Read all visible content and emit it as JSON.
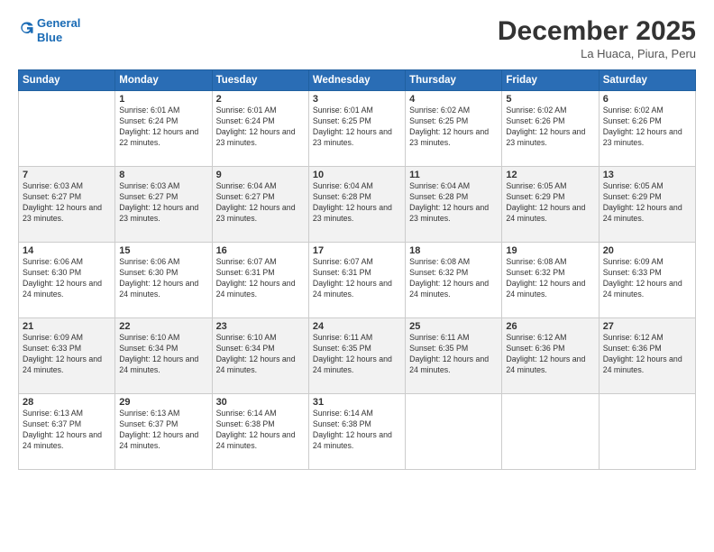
{
  "header": {
    "logo_line1": "General",
    "logo_line2": "Blue",
    "month": "December 2025",
    "location": "La Huaca, Piura, Peru"
  },
  "weekdays": [
    "Sunday",
    "Monday",
    "Tuesday",
    "Wednesday",
    "Thursday",
    "Friday",
    "Saturday"
  ],
  "weeks": [
    [
      {
        "day": "",
        "sunrise": "",
        "sunset": "",
        "daylight": ""
      },
      {
        "day": "1",
        "sunrise": "6:01 AM",
        "sunset": "6:24 PM",
        "daylight": "12 hours and 22 minutes."
      },
      {
        "day": "2",
        "sunrise": "6:01 AM",
        "sunset": "6:24 PM",
        "daylight": "12 hours and 23 minutes."
      },
      {
        "day": "3",
        "sunrise": "6:01 AM",
        "sunset": "6:25 PM",
        "daylight": "12 hours and 23 minutes."
      },
      {
        "day": "4",
        "sunrise": "6:02 AM",
        "sunset": "6:25 PM",
        "daylight": "12 hours and 23 minutes."
      },
      {
        "day": "5",
        "sunrise": "6:02 AM",
        "sunset": "6:26 PM",
        "daylight": "12 hours and 23 minutes."
      },
      {
        "day": "6",
        "sunrise": "6:02 AM",
        "sunset": "6:26 PM",
        "daylight": "12 hours and 23 minutes."
      }
    ],
    [
      {
        "day": "7",
        "sunrise": "6:03 AM",
        "sunset": "6:27 PM",
        "daylight": "12 hours and 23 minutes."
      },
      {
        "day": "8",
        "sunrise": "6:03 AM",
        "sunset": "6:27 PM",
        "daylight": "12 hours and 23 minutes."
      },
      {
        "day": "9",
        "sunrise": "6:04 AM",
        "sunset": "6:27 PM",
        "daylight": "12 hours and 23 minutes."
      },
      {
        "day": "10",
        "sunrise": "6:04 AM",
        "sunset": "6:28 PM",
        "daylight": "12 hours and 23 minutes."
      },
      {
        "day": "11",
        "sunrise": "6:04 AM",
        "sunset": "6:28 PM",
        "daylight": "12 hours and 23 minutes."
      },
      {
        "day": "12",
        "sunrise": "6:05 AM",
        "sunset": "6:29 PM",
        "daylight": "12 hours and 24 minutes."
      },
      {
        "day": "13",
        "sunrise": "6:05 AM",
        "sunset": "6:29 PM",
        "daylight": "12 hours and 24 minutes."
      }
    ],
    [
      {
        "day": "14",
        "sunrise": "6:06 AM",
        "sunset": "6:30 PM",
        "daylight": "12 hours and 24 minutes."
      },
      {
        "day": "15",
        "sunrise": "6:06 AM",
        "sunset": "6:30 PM",
        "daylight": "12 hours and 24 minutes."
      },
      {
        "day": "16",
        "sunrise": "6:07 AM",
        "sunset": "6:31 PM",
        "daylight": "12 hours and 24 minutes."
      },
      {
        "day": "17",
        "sunrise": "6:07 AM",
        "sunset": "6:31 PM",
        "daylight": "12 hours and 24 minutes."
      },
      {
        "day": "18",
        "sunrise": "6:08 AM",
        "sunset": "6:32 PM",
        "daylight": "12 hours and 24 minutes."
      },
      {
        "day": "19",
        "sunrise": "6:08 AM",
        "sunset": "6:32 PM",
        "daylight": "12 hours and 24 minutes."
      },
      {
        "day": "20",
        "sunrise": "6:09 AM",
        "sunset": "6:33 PM",
        "daylight": "12 hours and 24 minutes."
      }
    ],
    [
      {
        "day": "21",
        "sunrise": "6:09 AM",
        "sunset": "6:33 PM",
        "daylight": "12 hours and 24 minutes."
      },
      {
        "day": "22",
        "sunrise": "6:10 AM",
        "sunset": "6:34 PM",
        "daylight": "12 hours and 24 minutes."
      },
      {
        "day": "23",
        "sunrise": "6:10 AM",
        "sunset": "6:34 PM",
        "daylight": "12 hours and 24 minutes."
      },
      {
        "day": "24",
        "sunrise": "6:11 AM",
        "sunset": "6:35 PM",
        "daylight": "12 hours and 24 minutes."
      },
      {
        "day": "25",
        "sunrise": "6:11 AM",
        "sunset": "6:35 PM",
        "daylight": "12 hours and 24 minutes."
      },
      {
        "day": "26",
        "sunrise": "6:12 AM",
        "sunset": "6:36 PM",
        "daylight": "12 hours and 24 minutes."
      },
      {
        "day": "27",
        "sunrise": "6:12 AM",
        "sunset": "6:36 PM",
        "daylight": "12 hours and 24 minutes."
      }
    ],
    [
      {
        "day": "28",
        "sunrise": "6:13 AM",
        "sunset": "6:37 PM",
        "daylight": "12 hours and 24 minutes."
      },
      {
        "day": "29",
        "sunrise": "6:13 AM",
        "sunset": "6:37 PM",
        "daylight": "12 hours and 24 minutes."
      },
      {
        "day": "30",
        "sunrise": "6:14 AM",
        "sunset": "6:38 PM",
        "daylight": "12 hours and 24 minutes."
      },
      {
        "day": "31",
        "sunrise": "6:14 AM",
        "sunset": "6:38 PM",
        "daylight": "12 hours and 24 minutes."
      },
      {
        "day": "",
        "sunrise": "",
        "sunset": "",
        "daylight": ""
      },
      {
        "day": "",
        "sunrise": "",
        "sunset": "",
        "daylight": ""
      },
      {
        "day": "",
        "sunrise": "",
        "sunset": "",
        "daylight": ""
      }
    ]
  ]
}
